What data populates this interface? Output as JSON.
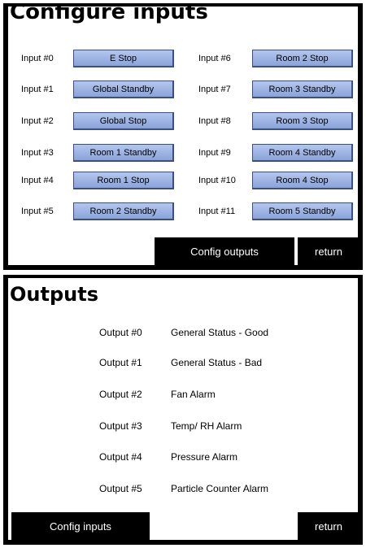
{
  "configure_inputs": {
    "title": "Configure inputs",
    "left_inputs": [
      {
        "label": "Input #0",
        "button": "E Stop"
      },
      {
        "label": "Input #1",
        "button": "Global Standby"
      },
      {
        "label": "Input #2",
        "button": "Global Stop"
      },
      {
        "label": "Input #3",
        "button": "Room 1 Standby"
      },
      {
        "label": "Input #4",
        "button": "Room 1 Stop"
      },
      {
        "label": "Input #5",
        "button": "Room 2 Standby"
      }
    ],
    "right_inputs": [
      {
        "label": "Input #6",
        "button": "Room 2 Stop"
      },
      {
        "label": "Input #7",
        "button": "Room 3 Standby"
      },
      {
        "label": "Input #8",
        "button": "Room 3 Stop"
      },
      {
        "label": "Input #9",
        "button": "Room 4 Standby"
      },
      {
        "label": "Input #10",
        "button": "Room 4 Stop"
      },
      {
        "label": "Input #11",
        "button": "Room 5 Standby"
      }
    ],
    "config_outputs_label": "Config outputs",
    "return_label": "return"
  },
  "outputs": {
    "title": "Outputs",
    "items": [
      {
        "label": "Output #0",
        "desc": "General Status - Good"
      },
      {
        "label": "Output #1",
        "desc": "General Status - Bad"
      },
      {
        "label": "Output #2",
        "desc": "Fan Alarm"
      },
      {
        "label": "Output #3",
        "desc": "Temp/ RH Alarm"
      },
      {
        "label": "Output #4",
        "desc": "Pressure Alarm"
      },
      {
        "label": "Output #5",
        "desc": "Particle Counter Alarm"
      }
    ],
    "config_inputs_label": "Config inputs",
    "return_label": "return"
  }
}
